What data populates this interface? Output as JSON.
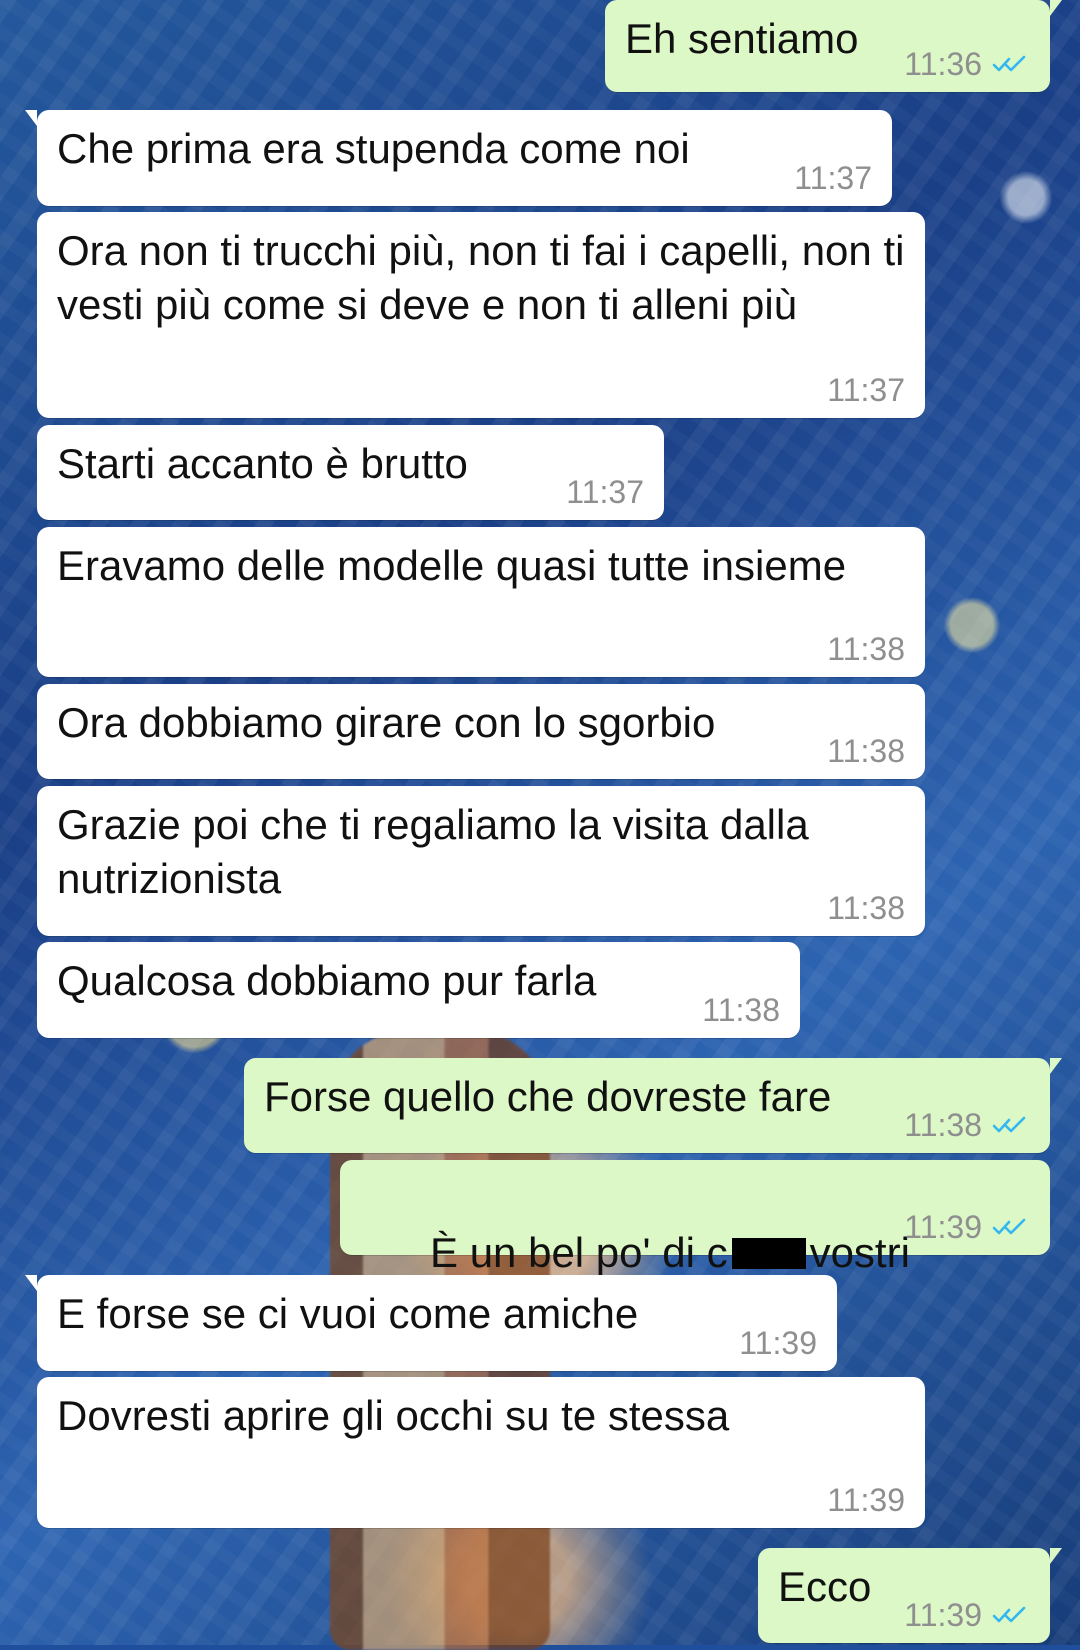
{
  "chat": {
    "messages": [
      {
        "direction": "outgoing",
        "text": "Eh sentiamo",
        "time": "11:36",
        "status": "read"
      },
      {
        "direction": "incoming",
        "text": "Che prima era stupenda come noi",
        "time": "11:37"
      },
      {
        "direction": "incoming",
        "text": "Ora non ti trucchi più, non ti fai i capelli, non ti vesti più come si deve e non ti alleni più",
        "time": "11:37"
      },
      {
        "direction": "incoming",
        "text": "Starti accanto è brutto",
        "time": "11:37"
      },
      {
        "direction": "incoming",
        "text": "Eravamo delle modelle quasi tutte insieme",
        "time": "11:38"
      },
      {
        "direction": "incoming",
        "text": "Ora dobbiamo girare con lo sgorbio",
        "time": "11:38"
      },
      {
        "direction": "incoming",
        "text": "Grazie poi che ti regaliamo la visita dalla nutrizionista",
        "time": "11:38"
      },
      {
        "direction": "incoming",
        "text": "Qualcosa dobbiamo pur farla",
        "time": "11:38"
      },
      {
        "direction": "outgoing",
        "text": "Forse quello che dovreste fare",
        "time": "11:38",
        "status": "read"
      },
      {
        "direction": "outgoing",
        "text_prefix": "È un bel po' di c",
        "text_suffix": "vostri",
        "time": "11:39",
        "status": "read"
      },
      {
        "direction": "incoming",
        "text": "E forse se ci vuoi come amiche",
        "time": "11:39"
      },
      {
        "direction": "incoming",
        "text": "Dovresti aprire gli occhi su te stessa",
        "time": "11:39"
      },
      {
        "direction": "outgoing",
        "text": "Ecco",
        "time": "11:39",
        "status": "read"
      }
    ]
  },
  "colors": {
    "incoming_bubble": "#ffffff",
    "outgoing_bubble": "#dcf8c6",
    "timestamp": "#8f8f8f",
    "read_ticks": "#34b7f1"
  },
  "icons": {
    "read_receipt": "double-check-icon"
  }
}
